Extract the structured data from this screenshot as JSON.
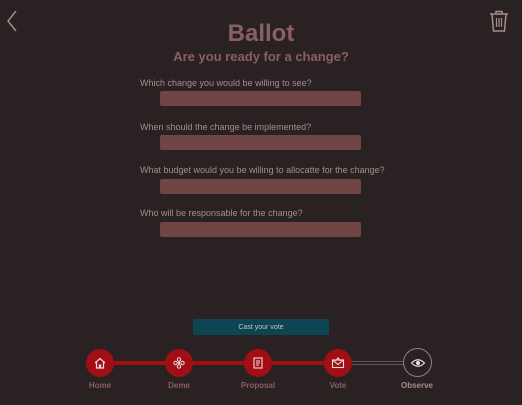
{
  "header": {
    "title": "Ballot",
    "subtitle": "Are you ready for a change?"
  },
  "questions": [
    {
      "label": "Which change you would be willing to see?",
      "value": ""
    },
    {
      "label": "When should the change be implemented?",
      "value": ""
    },
    {
      "label": "What budget would you be willing to allocatte for the change?",
      "value": ""
    },
    {
      "label": "Who will be responsable for the change?",
      "value": ""
    }
  ],
  "actions": {
    "cast_label": "Cast your vote"
  },
  "icons": {
    "back": "chevron-left-icon",
    "delete": "trash-icon"
  },
  "stepper": {
    "steps": [
      {
        "label": "Home",
        "icon": "home-icon",
        "state": "done"
      },
      {
        "label": "Deme",
        "icon": "flower-icon",
        "state": "done"
      },
      {
        "label": "Proposal",
        "icon": "scroll-icon",
        "state": "done"
      },
      {
        "label": "Vote",
        "icon": "envelope-icon",
        "state": "current"
      },
      {
        "label": "Observe",
        "icon": "eye-icon",
        "state": "pending"
      }
    ]
  },
  "colors": {
    "background": "#2a2122",
    "accent": "#a10f14",
    "title": "#8a5f63",
    "input": "#714446",
    "button": "#0e4552"
  }
}
